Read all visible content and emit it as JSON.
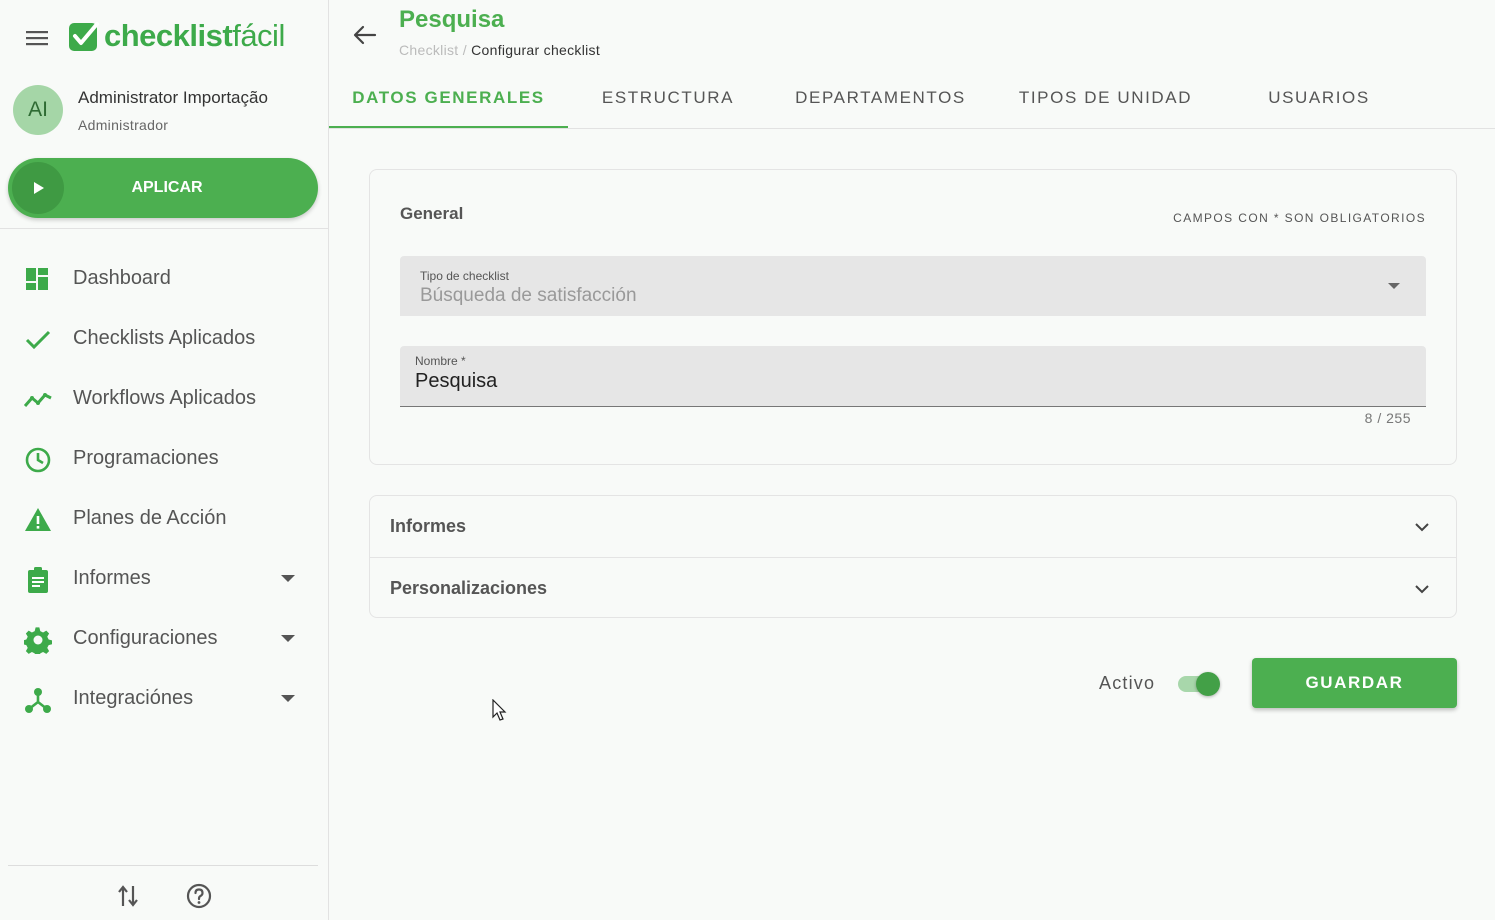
{
  "app": {
    "logo_text_bold": "checklist",
    "logo_text_light": "fácil",
    "brand_color": "#4caf50"
  },
  "user": {
    "initials": "AI",
    "name": "Administrator Importação",
    "role": "Administrador"
  },
  "apply_button": {
    "label": "APLICAR"
  },
  "sidebar": {
    "items": [
      {
        "label": "Dashboard",
        "icon": "dashboard-icon",
        "has_caret": false
      },
      {
        "label": "Checklists Aplicados",
        "icon": "check-icon",
        "has_caret": false
      },
      {
        "label": "Workflows Aplicados",
        "icon": "trending-icon",
        "has_caret": false
      },
      {
        "label": "Programaciones",
        "icon": "clock-icon",
        "has_caret": false
      },
      {
        "label": "Planes de Acción",
        "icon": "warning-icon",
        "has_caret": false
      },
      {
        "label": "Informes",
        "icon": "clipboard-icon",
        "has_caret": true
      },
      {
        "label": "Configuraciones",
        "icon": "gear-icon",
        "has_caret": true
      },
      {
        "label": "Integraciónes",
        "icon": "hub-icon",
        "has_caret": true
      }
    ]
  },
  "header": {
    "title": "Pesquisa",
    "breadcrumb": {
      "parent": "Checklist",
      "separator": "/",
      "current": "Configurar checklist"
    }
  },
  "tabs": [
    {
      "label": "DATOS GENERALES",
      "active": true
    },
    {
      "label": "ESTRUCTURA",
      "active": false
    },
    {
      "label": "DEPARTAMENTOS",
      "active": false
    },
    {
      "label": "TIPOS DE UNIDAD",
      "active": false
    },
    {
      "label": "USUARIOS",
      "active": false
    }
  ],
  "general": {
    "title": "General",
    "required_note": "CAMPOS CON * SON OBLIGATORIOS",
    "type_field": {
      "label": "Tipo de checklist",
      "value": "Búsqueda de satisfacción"
    },
    "name_field": {
      "label": "Nombre *",
      "value": "Pesquisa",
      "counter": "8 / 255"
    }
  },
  "accordion": [
    {
      "label": "Informes"
    },
    {
      "label": "Personalizaciones"
    }
  ],
  "footer": {
    "active_label": "Activo",
    "active_on": true,
    "save_label": "GUARDAR"
  }
}
